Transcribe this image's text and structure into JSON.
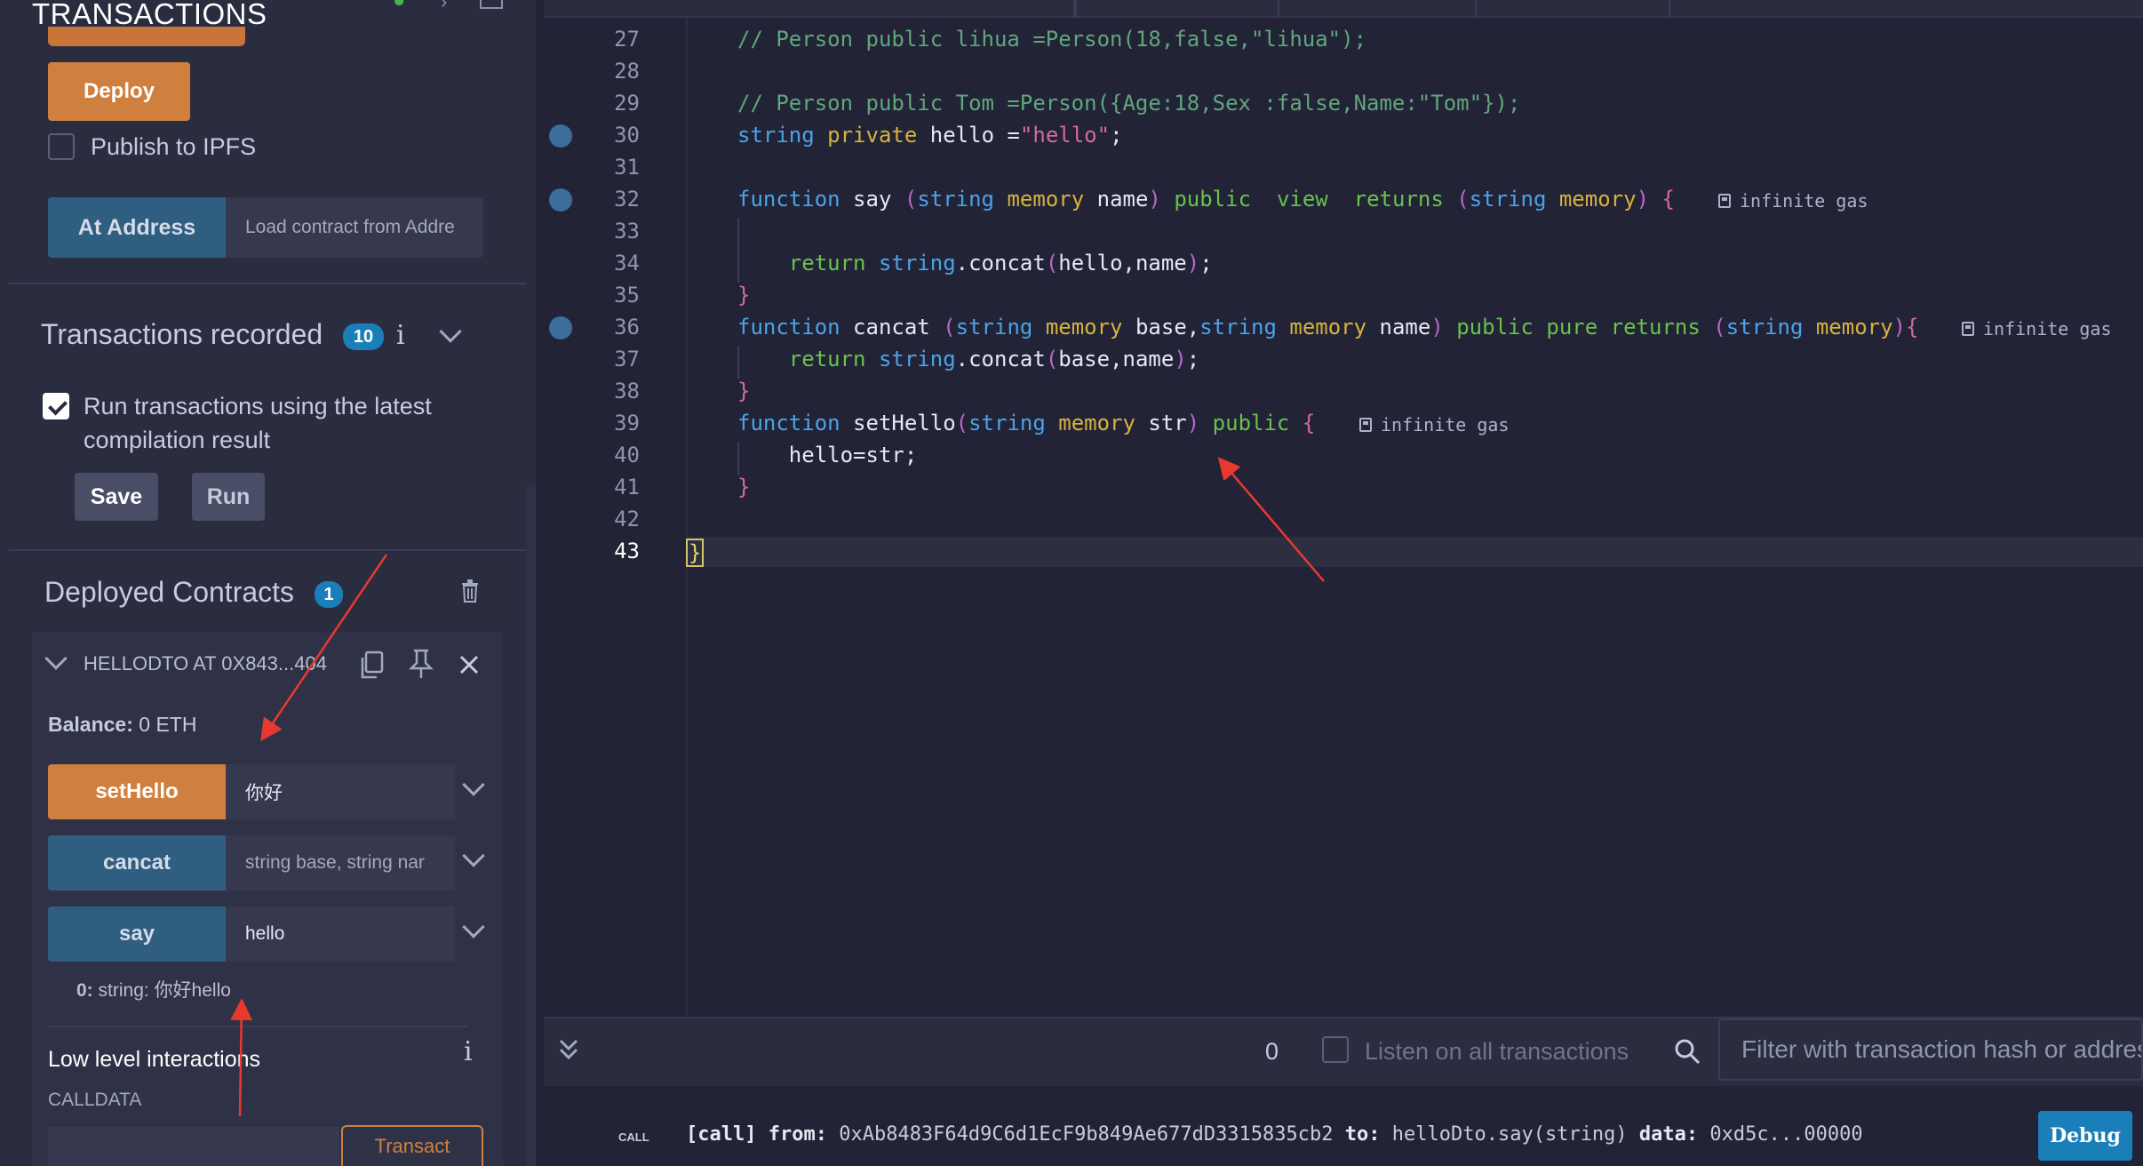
{
  "left_panel": {
    "title": "TRANSACTIONS",
    "deploy_label": "Deploy",
    "publish_ipfs_label": "Publish to IPFS",
    "at_address_label": "At Address",
    "at_address_placeholder": "Load contract from Addre",
    "transactions_recorded_label": "Transactions recorded",
    "transactions_recorded_count": "10",
    "info_icon": "i",
    "run_latest_label_line1": "Run transactions using the latest",
    "run_latest_label_line2": "compilation result",
    "save_label": "Save",
    "run_label": "Run",
    "deployed_contracts_label": "Deployed Contracts",
    "deployed_contracts_count": "1",
    "contract": {
      "name": "HELLODTO AT 0X843...404",
      "balance_label": "Balance:",
      "balance_value": "0 ETH",
      "functions": [
        {
          "name": "setHello",
          "input": "你好",
          "type": "transact"
        },
        {
          "name": "cancat",
          "input": "string base, string nar",
          "type": "call"
        },
        {
          "name": "say",
          "input": "hello",
          "type": "call"
        }
      ],
      "result_index": "0:",
      "result_value": "string: 你好hello"
    },
    "low_level_label": "Low level interactions",
    "calldata_label": "CALLDATA",
    "transact_label": "Transact"
  },
  "editor": {
    "line_numbers": [
      "27",
      "28",
      "29",
      "30",
      "31",
      "32",
      "33",
      "34",
      "35",
      "36",
      "37",
      "38",
      "39",
      "40",
      "41",
      "42",
      "43"
    ],
    "active_line": "43",
    "gas_label": "infinite gas"
  },
  "terminal": {
    "count": "0",
    "listen_label": "Listen on all transactions",
    "filter_placeholder": "Filter with transaction hash or address",
    "call_tag": "CALL",
    "log_prefix": "[call]",
    "log_from_label": "from:",
    "log_from": "0xAb8483F64d9C6d1EcF9b849Ae677dD3315835cb2",
    "log_to_label": "to:",
    "log_to": "helloDto.say(string)",
    "log_data_label": "data:",
    "log_data": "0xd5c...00000",
    "debug_label": "Debug"
  },
  "colors": {
    "accent_orange": "#d0803e",
    "accent_blue": "#2f5e80",
    "badge_blue": "#1a7fb8",
    "annotation_red": "#e8392f"
  }
}
